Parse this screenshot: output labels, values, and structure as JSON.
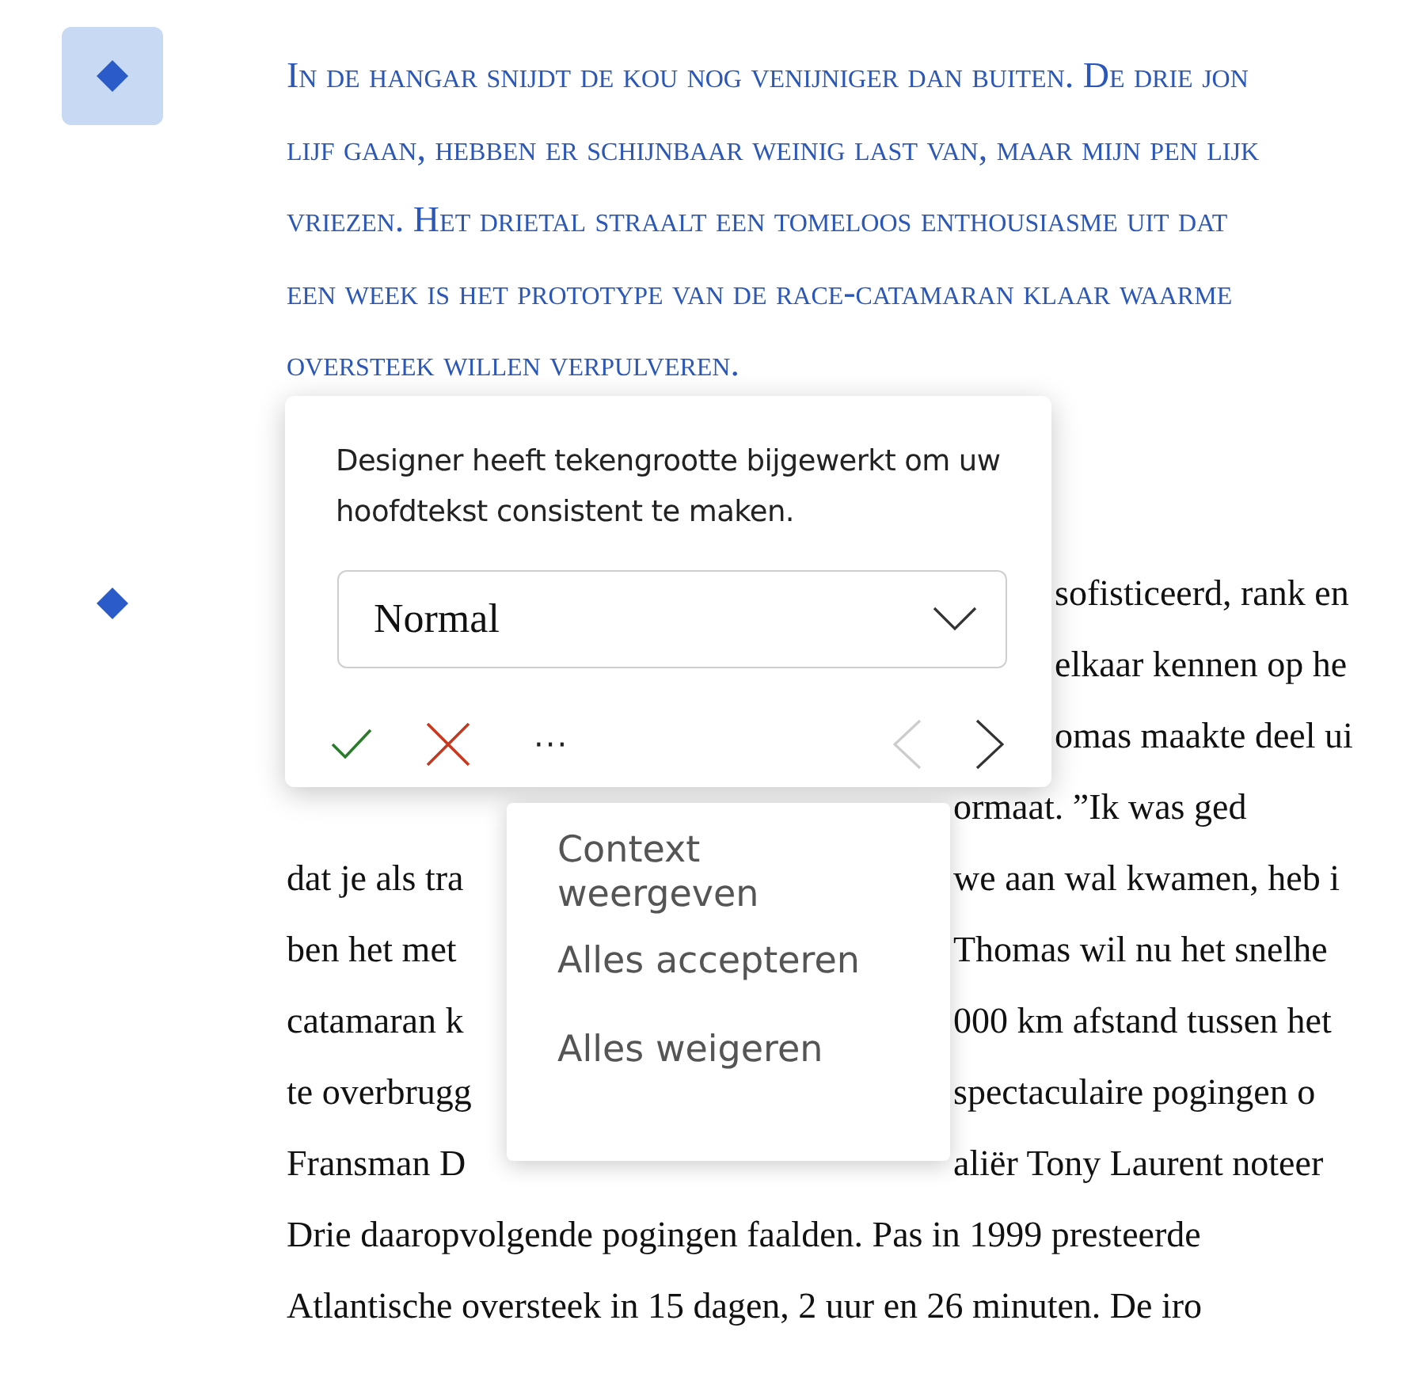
{
  "heading": {
    "marker_selected": true,
    "lines": [
      "In de hangar snijdt de kou nog venijniger dan buiten. De drie jon",
      "lijf gaan, hebben er schijnbaar weinig last van, maar mijn pen lijk",
      "vriezen. Het drietal straalt een tomeloos enthousiasme uit dat",
      "een week is het prototype van de race-catamaran klaar waarme",
      "oversteek willen verpulveren."
    ]
  },
  "body": {
    "marker_selected": false,
    "lines": [
      {
        "kind": "popup",
        "right": "sofisticeerd, rank en"
      },
      {
        "kind": "popup",
        "right": "elkaar kennen op he"
      },
      {
        "kind": "popup",
        "right": "omas maakte deel ui"
      },
      {
        "kind": "menu",
        "right": "ormaat. ”Ik was ged"
      },
      {
        "kind": "menu",
        "left": "dat je als tra",
        "right": "we aan wal kwamen, heb i"
      },
      {
        "kind": "menu",
        "left": "ben het met",
        "right": "Thomas wil nu het snelhe"
      },
      {
        "kind": "menu",
        "left": "catamaran k",
        "right": "000 km afstand tussen het"
      },
      {
        "kind": "menu",
        "left": "te overbrugg",
        "right": "spectaculaire pogingen o"
      },
      {
        "kind": "menu",
        "left": "Fransman D",
        "right": "aliër Tony Laurent noteer"
      },
      {
        "kind": "full",
        "segments": [
          {
            "text": "Drie daaropvolgende pogingen faalden. Pas in 1999 presteerde"
          }
        ]
      },
      {
        "kind": "full",
        "segments": [
          {
            "text": "Atlantische oversteek in 15 dagen, 2 uur en 26 minuten. De iro"
          }
        ]
      }
    ]
  },
  "popup": {
    "message": "Designer heeft tekengrootte bijgewerkt om uw hoofdtekst consistent te maken.",
    "style_value": "Normal",
    "more": "···",
    "previous_disabled": true,
    "next_disabled": false
  },
  "menu": {
    "items": [
      "Context weergeven",
      "Alles accepteren",
      "Alles weigeren"
    ]
  }
}
